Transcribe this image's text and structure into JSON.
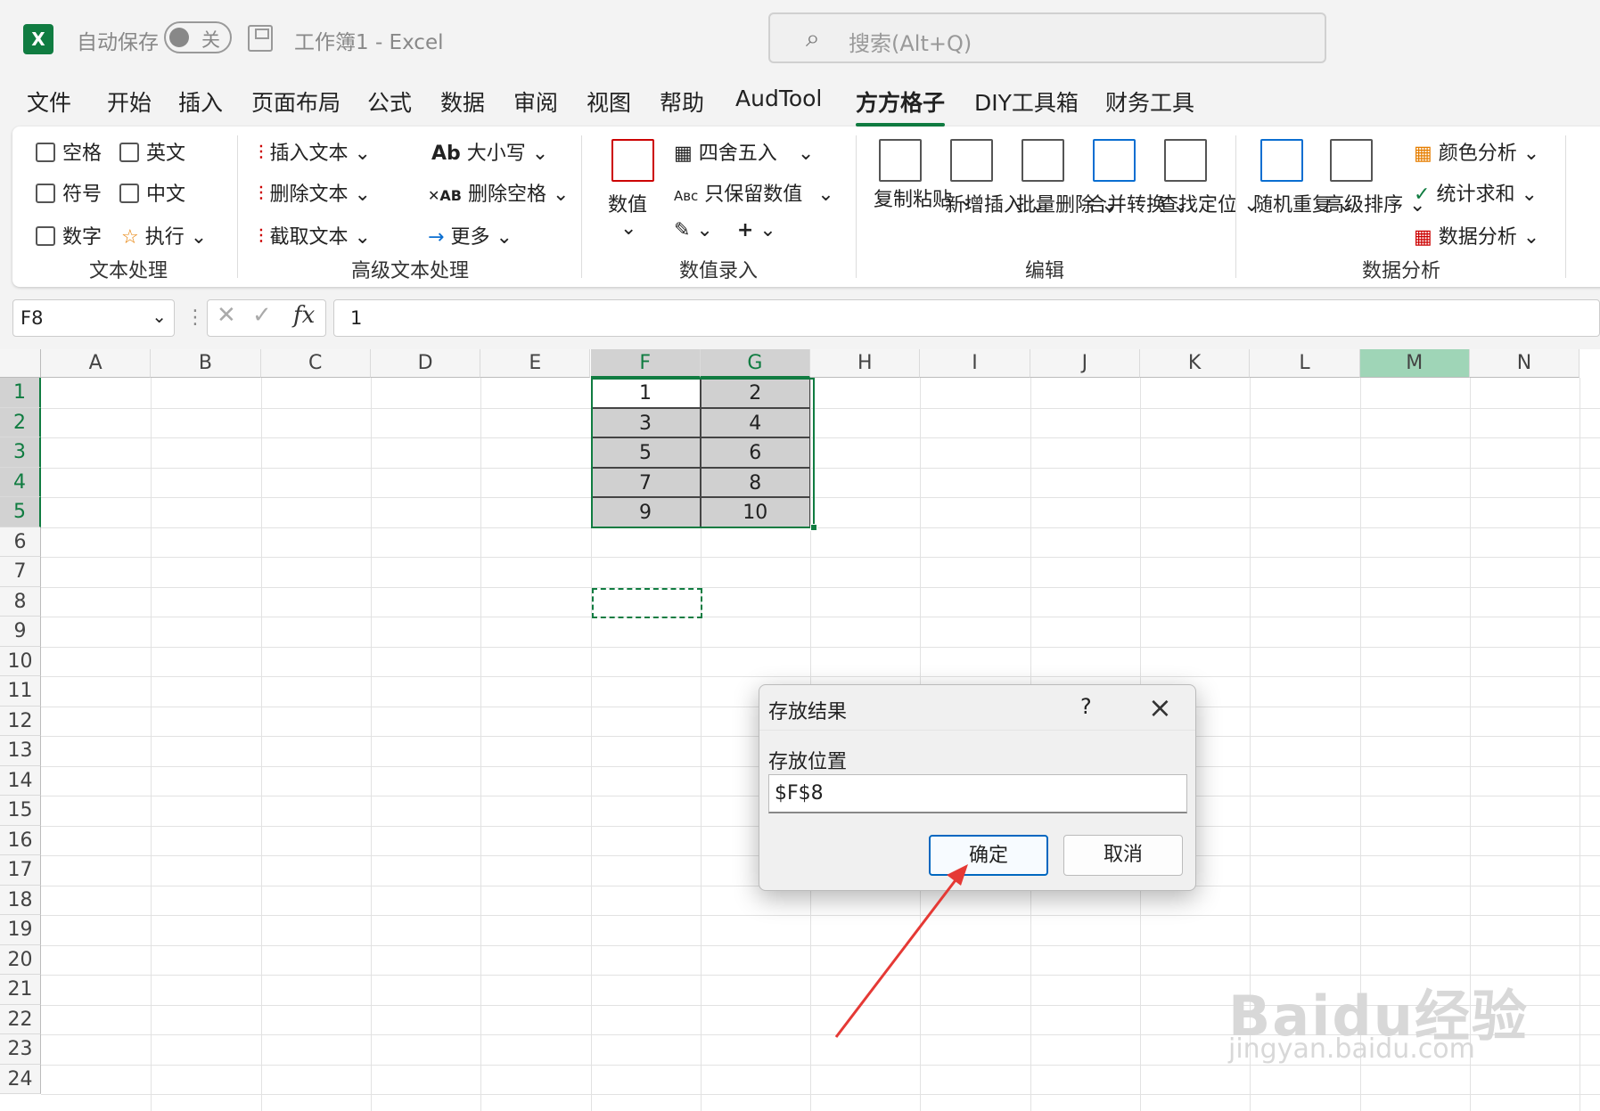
{
  "titlebar": {
    "autosave_label": "自动保存",
    "autosave_state": "关",
    "doc_title": "工作簿1 - Excel",
    "search_placeholder": "搜索(Alt+Q)"
  },
  "tabs": [
    "文件",
    "开始",
    "插入",
    "页面布局",
    "公式",
    "数据",
    "审阅",
    "视图",
    "帮助",
    "AudTool",
    "方方格子",
    "DIY工具箱",
    "财务工具"
  ],
  "active_tab": "方方格子",
  "ribbon": {
    "text_processing": {
      "checks": [
        "空格",
        "英文",
        "符号",
        "中文",
        "数字"
      ],
      "exec": "执行",
      "group": "文本处理"
    },
    "advanced_text": {
      "items": [
        "插入文本",
        "删除文本",
        "截取文本",
        "大小写",
        "删除空格",
        "更多"
      ],
      "group": "高级文本处理"
    },
    "numeric": {
      "value": "数值",
      "round": "四舍五入",
      "keep": "只保留数值",
      "group": "数值录入"
    },
    "edit": {
      "items": [
        "复制粘贴",
        "新增插入",
        "批量删除",
        "合并转换",
        "查找定位"
      ],
      "group": "编辑"
    },
    "analysis": {
      "items": [
        "随机重复",
        "高级排序",
        "颜色分析",
        "统计求和",
        "数据分析"
      ],
      "group": "数据分析"
    }
  },
  "formula": {
    "cell_ref": "F8",
    "value": "1"
  },
  "columns": [
    "A",
    "B",
    "C",
    "D",
    "E",
    "F",
    "G",
    "H",
    "I",
    "J",
    "K",
    "L",
    "M",
    "N"
  ],
  "rows": [
    "1",
    "2",
    "3",
    "4",
    "5",
    "6",
    "7",
    "8",
    "9",
    "10",
    "11",
    "12",
    "13",
    "14",
    "15",
    "16",
    "17",
    "18",
    "19",
    "20",
    "21",
    "22",
    "23",
    "24"
  ],
  "cells": [
    [
      "1",
      "2"
    ],
    [
      "3",
      "4"
    ],
    [
      "5",
      "6"
    ],
    [
      "7",
      "8"
    ],
    [
      "9",
      "10"
    ]
  ],
  "dialog": {
    "title": "存放结果",
    "help": "?",
    "label": "存放位置",
    "value": "$F$8",
    "ok": "确定",
    "cancel": "取消"
  },
  "watermark": {
    "main": "Baidu经验",
    "sub": "jingyan.baidu.com"
  }
}
